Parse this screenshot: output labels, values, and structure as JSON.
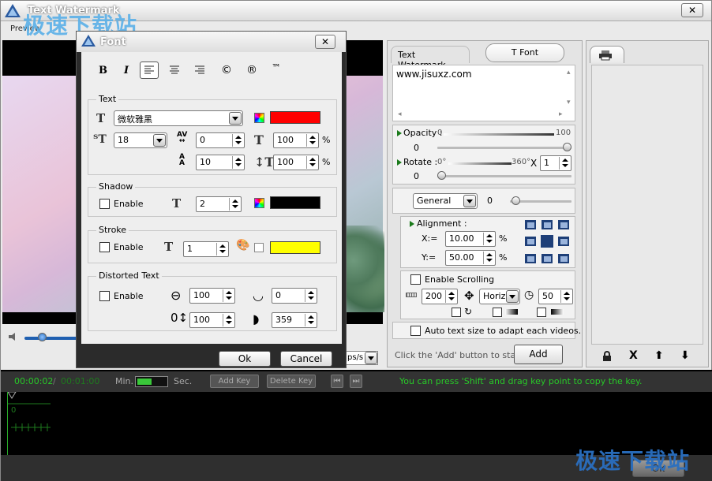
{
  "app": {
    "title": "Text Watermark",
    "menu_label": "Preview",
    "close_glyph": "✕"
  },
  "watermark_logo": "极速下载站",
  "dialog": {
    "title": "Font",
    "close_glyph": "✕",
    "toolbar": {
      "bold": "B",
      "italic": "I",
      "copyright": "©",
      "registered": "®",
      "trademark": "™"
    },
    "text_group": {
      "label": "Text",
      "font_name": "微软雅黑",
      "font_size": "18",
      "char_spacing": "0",
      "scale_x": "100",
      "line_spacing": "10",
      "scale_y": "100",
      "pct1": "%",
      "pct2": "%",
      "color": "#ff0000"
    },
    "shadow": {
      "label": "Shadow",
      "enable": "Enable",
      "size": "2",
      "color": "#000000"
    },
    "stroke": {
      "label": "Stroke",
      "enable": "Enable",
      "size": "1",
      "color": "#ffff00"
    },
    "distorted": {
      "label": "Distorted Text",
      "enable": "Enable",
      "v1": "100",
      "v2": "0",
      "v3": "100",
      "v4": "359"
    },
    "ok": "Ok",
    "cancel": "Cancel"
  },
  "right_panel": {
    "tabs": [
      "Text Watermark",
      "T Font"
    ],
    "text_content": "www.jisuxz.com",
    "opacity_label": "Opacity :",
    "opacity_min": "0",
    "opacity_max": "100",
    "opacity_value": "0",
    "rotate_label": "Rotate :",
    "rotate_min": "0°",
    "rotate_max": "360°",
    "rotate_x": "X",
    "rotate_mult": "1",
    "rotate_value": "0",
    "mode_select": "General",
    "mode_value": "0",
    "alignment_label": "Alignment :",
    "x_label": "X:=",
    "x_value": "10.00",
    "y_label": "Y:=",
    "y_value": "50.00",
    "pct": "%",
    "scrolling_label": "Enable Scrolling",
    "scroll_speed": "200",
    "scroll_dir": "Horiz",
    "scroll_time": "50",
    "auto_size_label": "Auto text size to adapt each videos.",
    "hint": "Click the 'Add' button to start ->",
    "add_button": "Add"
  },
  "right_panel2": {
    "lock": "🔒",
    "delete": "X",
    "up": "⬆",
    "down": "⬇"
  },
  "timeline": {
    "current_time": "00:00:02",
    "separator": "/",
    "total_time": "00:01:00",
    "min_label": "Min.",
    "sec_label": "Sec.",
    "add_key": "Add Key",
    "delete_key": "Delete Key",
    "hint": "You can press 'Shift' and drag key point to copy the key.",
    "ok": "Ok",
    "track_mark": "0"
  },
  "fps_value": "ps/s",
  "colors": {
    "timeline_text": "#28c828",
    "accent": "#1a7a1a"
  }
}
